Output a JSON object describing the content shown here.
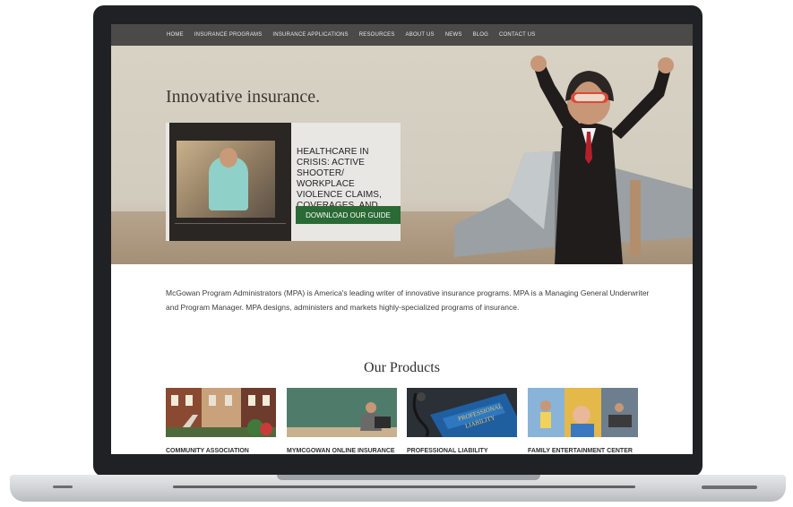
{
  "nav": {
    "items": [
      "HOME",
      "INSURANCE PROGRAMS",
      "INSURANCE APPLICATIONS",
      "RESOURCES",
      "ABOUT US",
      "NEWS",
      "BLOG",
      "CONTACT US"
    ]
  },
  "hero": {
    "title": "Innovative insurance.",
    "promo": {
      "headline": "HEALTHCARE IN CRISIS: ACTIVE SHOOTER/ WORKPLACE VIOLENCE CLAIMS, COVERAGES, AND CONSEQUENCES",
      "button_label": "DOWNLOAD OUR GUIDE"
    }
  },
  "intro": {
    "text": "McGowan Program Administrators (MPA) is America's leading writer of innovative insurance programs. MPA is a Managing General Underwriter and Program Manager. MPA designs, administers and markets highly-specialized programs of insurance."
  },
  "products": {
    "title": "Our Products",
    "items": [
      {
        "label": "COMMUNITY ASSOCIATION INSURANCE"
      },
      {
        "label": "MYMCGOWAN ONLINE INSURANCE"
      },
      {
        "label": "PROFESSIONAL LIABILITY INSURANCE"
      },
      {
        "label": "FAMILY ENTERTAINMENT CENTER INSURANCE"
      }
    ]
  },
  "colors": {
    "nav_bg": "#4b4a48",
    "button_green": "#2a6a34",
    "hero_bg": "#d8d2c4"
  }
}
